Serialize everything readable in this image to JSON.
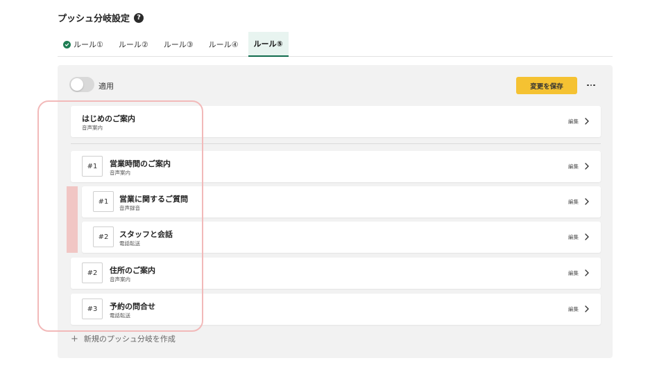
{
  "page": {
    "title": "プッシュ分岐設定",
    "help_glyph": "?"
  },
  "tabs": [
    {
      "label": "ルール①",
      "checked": true,
      "active": false
    },
    {
      "label": "ルール②",
      "checked": false,
      "active": false
    },
    {
      "label": "ルール③",
      "checked": false,
      "active": false
    },
    {
      "label": "ルール④",
      "checked": false,
      "active": false
    },
    {
      "label": "ルール⑤",
      "checked": false,
      "active": true
    }
  ],
  "toolbar": {
    "toggle_label": "適用",
    "toggle_on": false,
    "save_label": "変更を保存"
  },
  "intro": {
    "title": "はじめのご案内",
    "subtitle": "音声案内",
    "edit_label": "編集"
  },
  "branches": [
    {
      "number": "#1",
      "title": "営業時間のご案内",
      "subtitle": "音声案内",
      "edit_label": "編集"
    },
    {
      "number": "#1",
      "title": "営業に関するご質問",
      "subtitle": "音声録音",
      "edit_label": "編集"
    },
    {
      "number": "#2",
      "title": "スタッフと会話",
      "subtitle": "電話転送",
      "edit_label": "編集"
    },
    {
      "number": "#2",
      "title": "住所のご案内",
      "subtitle": "音声案内",
      "edit_label": "編集"
    },
    {
      "number": "#3",
      "title": "予約の問合せ",
      "subtitle": "電話転送",
      "edit_label": "編集"
    }
  ],
  "create": {
    "plus_glyph": "+",
    "label": "新規のプッシュ分岐を作成"
  },
  "colors": {
    "accent_green": "#1e7d53",
    "save_yellow": "#f5c232",
    "nest_bar": "#f1c6c4",
    "highlight": "#f2b9b9"
  }
}
